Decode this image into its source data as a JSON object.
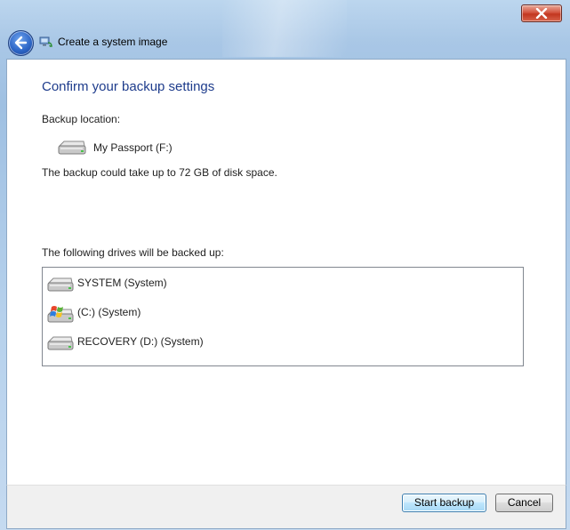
{
  "window": {
    "title": "Create a system image",
    "icons": {
      "close": "close-icon",
      "back": "back-arrow-icon",
      "app": "backup-icon"
    }
  },
  "page": {
    "heading": "Confirm your backup settings",
    "backup_location_label": "Backup location:",
    "backup_location": {
      "name": "My Passport (F:)",
      "icon": "external-drive-icon"
    },
    "space_notice": "The backup could take up to 72 GB of disk space.",
    "drives_label": "The following drives will be backed up:",
    "drives": [
      {
        "name": "SYSTEM (System)",
        "icon": "hard-drive-icon"
      },
      {
        "name": "(C:) (System)",
        "icon": "windows-drive-icon"
      },
      {
        "name": "RECOVERY (D:) (System)",
        "icon": "hard-drive-icon"
      }
    ]
  },
  "footer": {
    "start_label": "Start backup",
    "cancel_label": "Cancel"
  },
  "colors": {
    "heading": "#1e3c8c",
    "accent_button_border": "#3c7fb1",
    "close_button": "#c2361f"
  }
}
